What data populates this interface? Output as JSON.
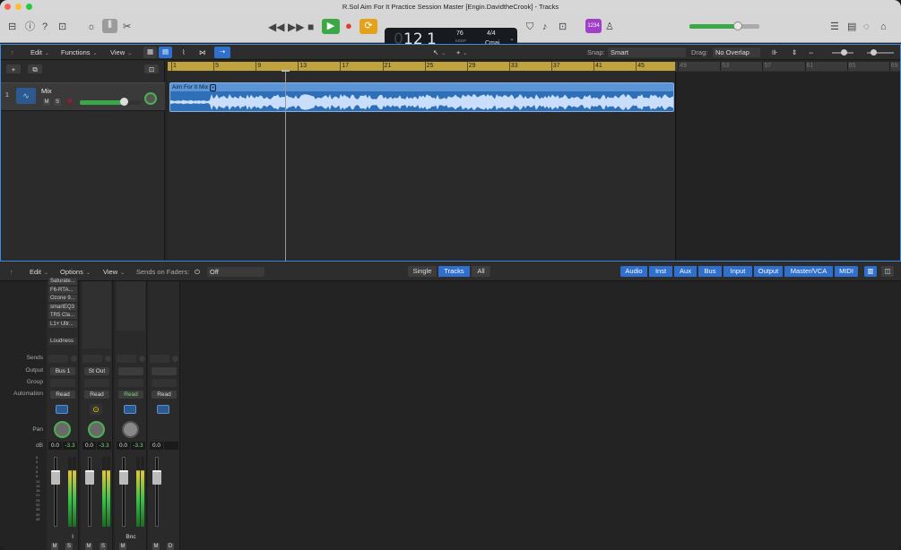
{
  "window": {
    "title": "R.Sol Aim For It Practice Session Master [Engin.DavidtheCrook] - Tracks"
  },
  "lcd": {
    "bar": "12",
    "beat": "1",
    "bar_label": "BAR",
    "beat_label": "BEAT",
    "tempo": "76",
    "keep_label": "KEEP",
    "tempo_label": "TEMPO",
    "signature": "4/4",
    "key": "Cmaj",
    "count_in": "1234"
  },
  "tracks_menu": {
    "edit": "Edit",
    "functions": "Functions",
    "view": "View",
    "snap_label": "Snap:",
    "snap_value": "Smart",
    "drag_label": "Drag:",
    "drag_value": "No Overlap"
  },
  "track": {
    "number": "1",
    "name": "Mix",
    "mute": "M",
    "solo": "S",
    "record": "R"
  },
  "region": {
    "name": "Aim For It Mix"
  },
  "ruler": {
    "bars": [
      "1",
      "5",
      "9",
      "13",
      "17",
      "21",
      "25",
      "29",
      "33",
      "37",
      "41",
      "45",
      "49",
      "53",
      "57",
      "61",
      "65",
      "69"
    ]
  },
  "mixer_menu": {
    "edit": "Edit",
    "options": "Options",
    "view": "View",
    "sends_on_faders": "Sends on Faders:",
    "sends_value": "Off"
  },
  "mixer_tabs": [
    "Single",
    "Tracks",
    "All"
  ],
  "mixer_filters": [
    "Audio",
    "Inst",
    "Aux",
    "Bus",
    "Input",
    "Output",
    "Master/VCA",
    "MIDI"
  ],
  "row_labels": {
    "sends": "Sends",
    "output": "Output",
    "group": "Group",
    "automation": "Automation",
    "pan": "Pan",
    "db": "dB"
  },
  "plugins": [
    "Saturate...",
    "F6-RTA...",
    "Ozone 9...",
    "smartEQ3",
    "TR5 Cla...",
    "L1+ Ultr...",
    "",
    "Loudness"
  ],
  "strips": [
    {
      "output": "Bus 1",
      "automation": "Read",
      "db1": "0.0",
      "db2": "-3.3",
      "bottom": "I",
      "m": "M",
      "s": "S"
    },
    {
      "output": "St Out",
      "automation": "Read",
      "db1": "0.0",
      "db2": "-3.3",
      "bottom": "",
      "m": "M",
      "s": "S"
    },
    {
      "output": "",
      "automation": "Read",
      "db1": "0.0",
      "db2": "-3.3",
      "bottom": "Bnc",
      "m": "M",
      "s": ""
    },
    {
      "output": "",
      "automation": "Read",
      "db1": "0.0",
      "db2": "",
      "bottom": "",
      "m": "M",
      "s": "D"
    }
  ],
  "fader_scale": [
    "6",
    "0",
    "3",
    "6",
    "9",
    "12",
    "15",
    "18",
    "21",
    "24",
    "30",
    "35",
    "40",
    "45"
  ]
}
